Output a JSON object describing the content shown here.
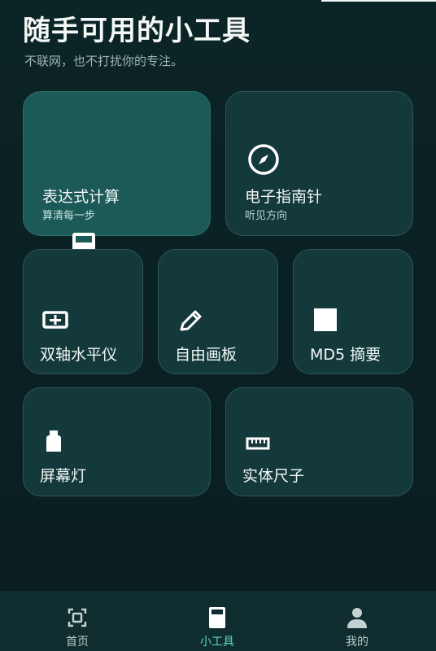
{
  "header": {
    "title": "随手可用的小工具",
    "subtitle": "不联网，也不打扰你的专注。"
  },
  "tools": {
    "calculator": {
      "label": "表达式计算",
      "sublabel": "算清每一步",
      "icon": "calculator-icon"
    },
    "compass": {
      "label": "电子指南针",
      "sublabel": "听见方向",
      "icon": "compass-icon"
    },
    "level": {
      "label": "双轴水平仪",
      "icon": "level-icon"
    },
    "drawing": {
      "label": "自由画板",
      "icon": "pencil-icon"
    },
    "md5": {
      "label": "MD5 摘要",
      "icon": "square-icon"
    },
    "flashlight": {
      "label": "屏幕灯",
      "icon": "lamp-icon"
    },
    "ruler": {
      "label": "实体尺子",
      "icon": "ruler-icon"
    }
  },
  "nav": {
    "items": [
      {
        "label": "首页",
        "icon": "scan-frame-icon"
      },
      {
        "label": "小工具",
        "icon": "calculator-icon",
        "selected": true
      },
      {
        "label": "我的",
        "icon": "person-icon"
      }
    ]
  },
  "colors": {
    "background": "#0b2325",
    "card": "#14393b",
    "card_active": "#1c5a58",
    "accent": "#5fd6c9"
  }
}
